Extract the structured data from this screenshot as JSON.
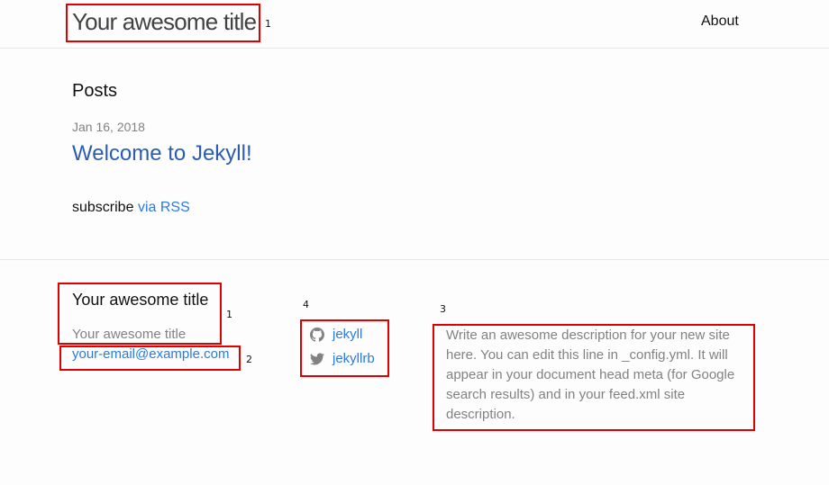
{
  "header": {
    "site_title": "Your awesome title",
    "nav": [
      {
        "label": "About"
      }
    ]
  },
  "main": {
    "posts_heading": "Posts",
    "posts": [
      {
        "date": "Jan 16, 2018",
        "title": "Welcome to Jekyll!"
      }
    ],
    "subscribe_prefix": "subscribe",
    "subscribe_link": "via RSS"
  },
  "footer": {
    "heading": "Your awesome title",
    "site_name": "Your awesome title",
    "email": "your-email@example.com",
    "social": [
      {
        "icon": "github-icon",
        "label": "jekyll"
      },
      {
        "icon": "twitter-icon",
        "label": "jekyllrb"
      }
    ],
    "description": "Write an awesome description for your new site here. You can edit this line in _config.yml. It will appear in your document head meta (for Google search results) and in your feed.xml site description."
  },
  "annotations": {
    "color": "#e00000",
    "markers": [
      "1",
      "1",
      "2",
      "4",
      "3"
    ]
  }
}
